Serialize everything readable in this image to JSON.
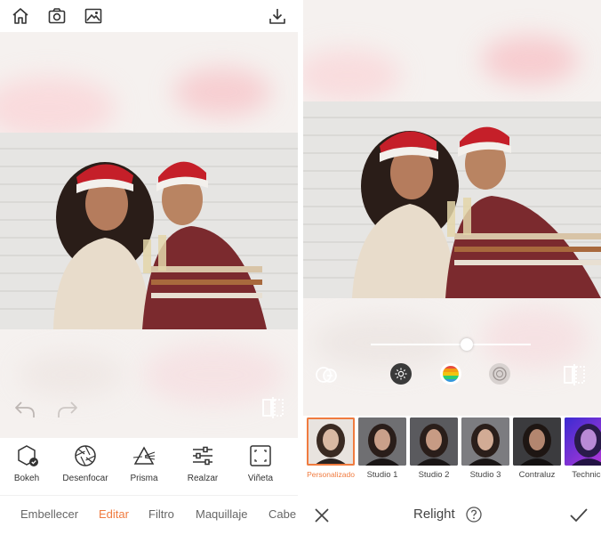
{
  "left_toolbar": {
    "home_icon": "home-icon",
    "camera_icon": "camera-icon",
    "gallery_icon": "image-icon",
    "download_icon": "download-icon"
  },
  "tools": [
    {
      "name": "bokeh",
      "label": "Bokeh",
      "icon": "hexagon-check-icon"
    },
    {
      "name": "desenfocar",
      "label": "Desenfocar",
      "icon": "aperture-icon"
    },
    {
      "name": "prisma",
      "label": "Prisma",
      "icon": "prism-icon"
    },
    {
      "name": "realzar",
      "label": "Realzar",
      "icon": "sliders-icon"
    },
    {
      "name": "vineta",
      "label": "Viñeta",
      "icon": "vignette-icon"
    }
  ],
  "tabs": [
    {
      "label": "Embellecer",
      "active": false
    },
    {
      "label": "Editar",
      "active": true
    },
    {
      "label": "Filtro",
      "active": false
    },
    {
      "label": "Maquillaje",
      "active": false
    },
    {
      "label": "Cabe",
      "active": false
    }
  ],
  "relight": {
    "slider_value": 0.6,
    "title": "Relight",
    "presets": [
      {
        "label": "Personalizado",
        "selected": true
      },
      {
        "label": "Studio 1",
        "selected": false
      },
      {
        "label": "Studio 2",
        "selected": false
      },
      {
        "label": "Studio 3",
        "selected": false
      },
      {
        "label": "Contraluz",
        "selected": false
      },
      {
        "label": "Technico",
        "selected": false
      }
    ]
  },
  "colors": {
    "accent": "#f07b3f",
    "canvas_bg": "#f5f1ef",
    "blush": "#f9c4c8"
  }
}
